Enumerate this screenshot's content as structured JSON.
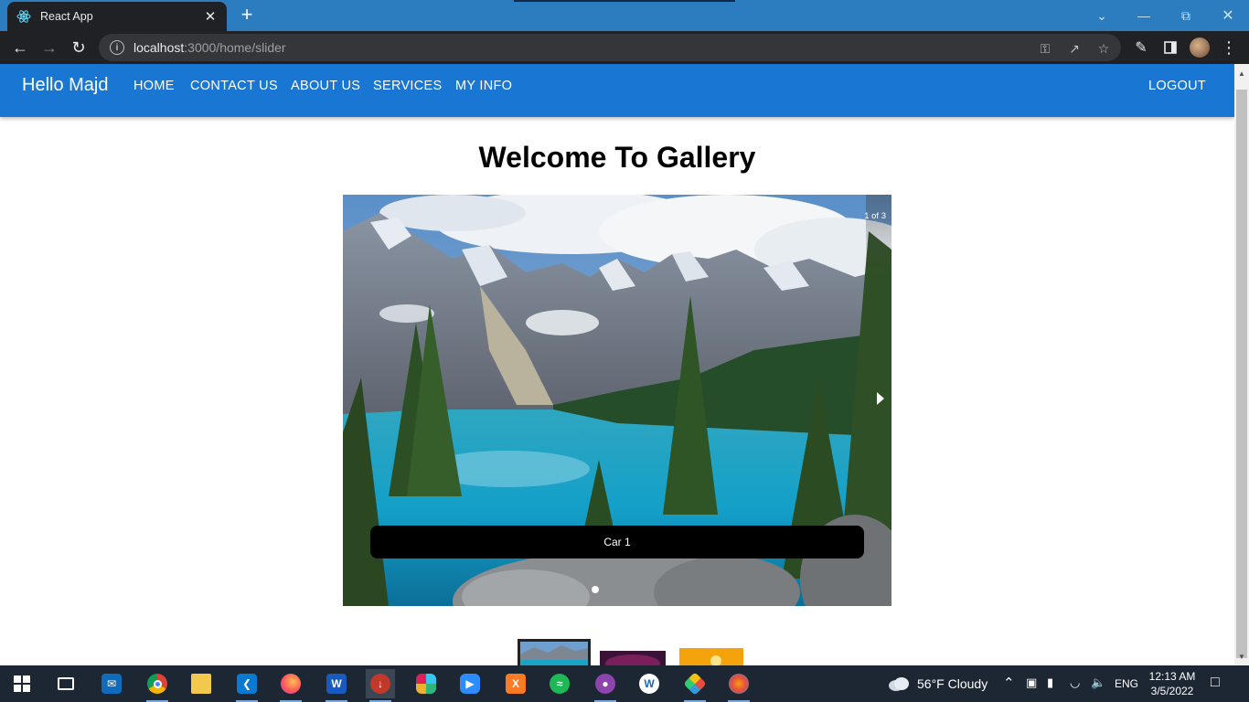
{
  "browser": {
    "tab_title": "React App",
    "url_host": "localhost",
    "url_path": ":3000/home/slider",
    "new_tab": "+",
    "close_tab": "✕"
  },
  "navbar": {
    "brand": "Hello Majd",
    "links": [
      "HOME",
      "CONTACT US",
      "ABOUT US",
      "SERVICES",
      "MY INFO"
    ],
    "logout": "LOGOUT",
    "color": "#1976d2"
  },
  "gallery": {
    "title": "Welcome To Gallery",
    "counter": "1 of 3",
    "caption": "Car 1",
    "current_slide": 1,
    "total_slides": 3,
    "thumbnails": [
      "mountain-lake",
      "purple-sky",
      "yellow-light"
    ]
  },
  "taskbar": {
    "weather": "56°F  Cloudy",
    "language": "ENG",
    "time": "12:13 AM",
    "date": "3/5/2022",
    "apps": [
      "task-view",
      "mail",
      "chrome",
      "file-explorer",
      "vscode",
      "firefox",
      "word",
      "git-tool",
      "slack",
      "zoom",
      "xampp",
      "spotify",
      "podcast",
      "writer",
      "sourcetree",
      "paint"
    ]
  }
}
